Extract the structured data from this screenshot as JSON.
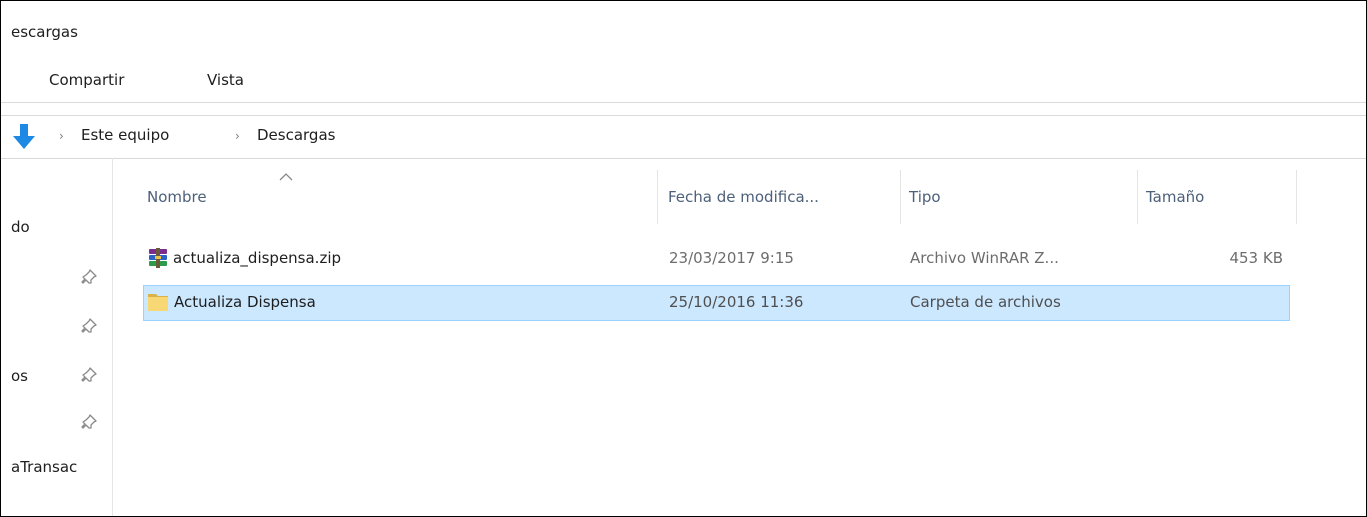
{
  "window": {
    "title": "escargas"
  },
  "ribbon": {
    "tabs": [
      {
        "label": "Compartir"
      },
      {
        "label": "Vista"
      }
    ]
  },
  "address_bar": {
    "nav_icon": "down-arrow-icon",
    "breadcrumbs": [
      {
        "label": "Este equipo"
      },
      {
        "label": "Descargas"
      }
    ],
    "separator": "›"
  },
  "nav_pane": {
    "items": [
      {
        "label": "do",
        "pinned": false
      },
      {
        "label": "",
        "pinned": true
      },
      {
        "label": "",
        "pinned": true
      },
      {
        "label": "os",
        "pinned": true
      },
      {
        "label": "",
        "pinned": true
      },
      {
        "label": "aTransac",
        "pinned": false
      }
    ],
    "pin_icon": "pin-icon"
  },
  "file_list": {
    "columns": [
      {
        "label": "Nombre",
        "sorted": "ascending"
      },
      {
        "label": "Fecha de modifica..."
      },
      {
        "label": "Tipo"
      },
      {
        "label": "Tamaño"
      }
    ],
    "rows": [
      {
        "icon": "winrar-archive-icon",
        "name": "actualiza_dispensa.zip",
        "modified": "23/03/2017 9:15",
        "type": "Archivo WinRAR Z...",
        "size": "453 KB",
        "selected": false
      },
      {
        "icon": "folder-icon",
        "name": "Actualiza Dispensa",
        "modified": "25/10/2016 11:36",
        "type": "Carpeta de archivos",
        "size": "",
        "selected": true
      }
    ]
  },
  "colors": {
    "selection_fill": "#cce8ff",
    "selection_border": "#99d1ff",
    "header_text": "#4c607a",
    "nav_arrow": "#1e88e5"
  }
}
